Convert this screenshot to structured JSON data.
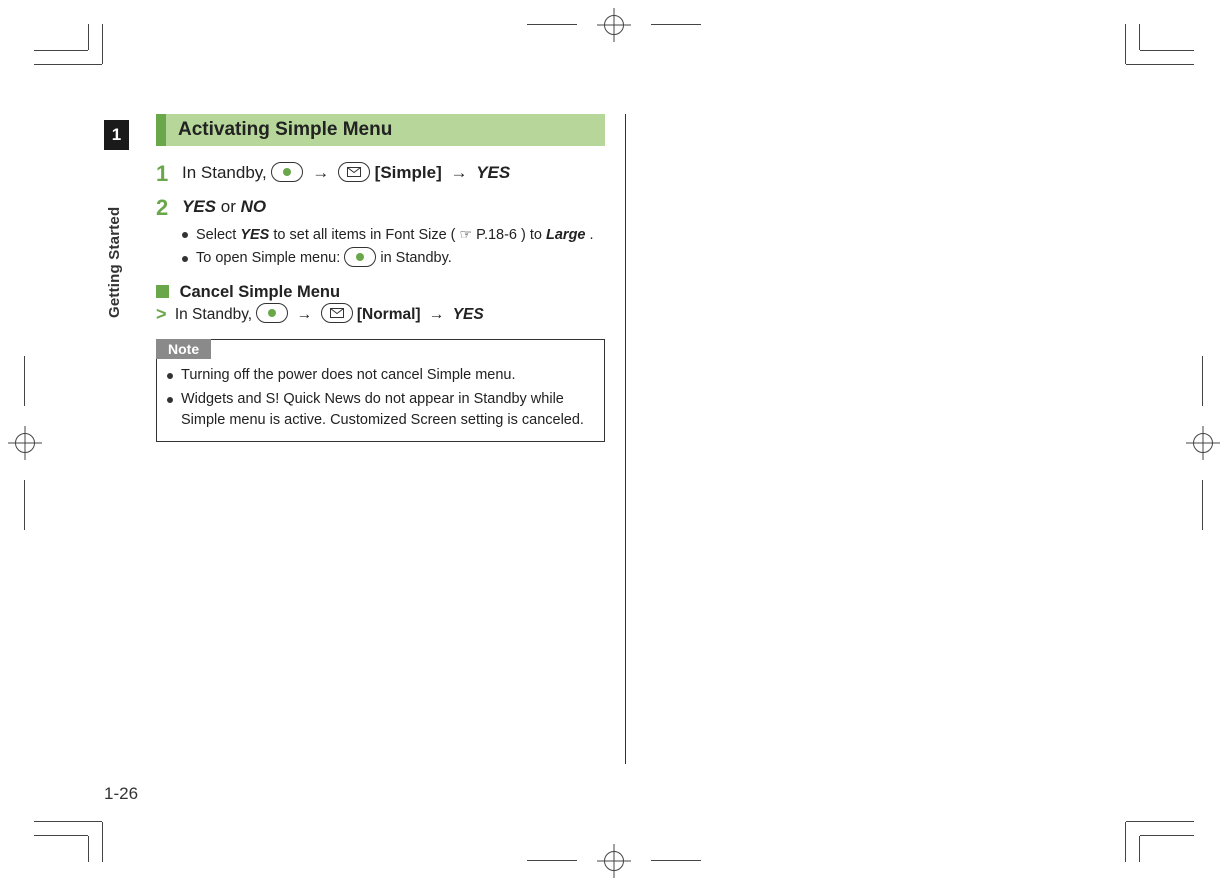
{
  "chapter": {
    "number": "1",
    "title": "Getting Started"
  },
  "page_number": "1-26",
  "heading": "Activating Simple Menu",
  "step1": {
    "num": "1",
    "pre": "In Standby, ",
    "bracket": "[Simple]",
    "yes": "YES"
  },
  "step2": {
    "num": "2",
    "yes": "YES",
    "or": " or ",
    "no": "NO",
    "b1_a": "Select ",
    "b1_yes": "YES",
    "b1_b": " to set all items in Font Size (",
    "b1_ref": "P.18-6",
    "b1_c": ") to ",
    "b1_large": "Large",
    "b1_d": ".",
    "b2_a": "To open Simple menu: ",
    "b2_b": " in Standby."
  },
  "cancel": {
    "title": "Cancel Simple Menu",
    "pre": "In Standby, ",
    "bracket": "[Normal]",
    "yes": "YES"
  },
  "arrow": "→",
  "note": {
    "label": "Note",
    "items": [
      "Turning off the power does not cancel Simple menu.",
      "Widgets and S! Quick News do not appear in Standby while Simple menu is active. Customized Screen setting is canceled."
    ]
  }
}
